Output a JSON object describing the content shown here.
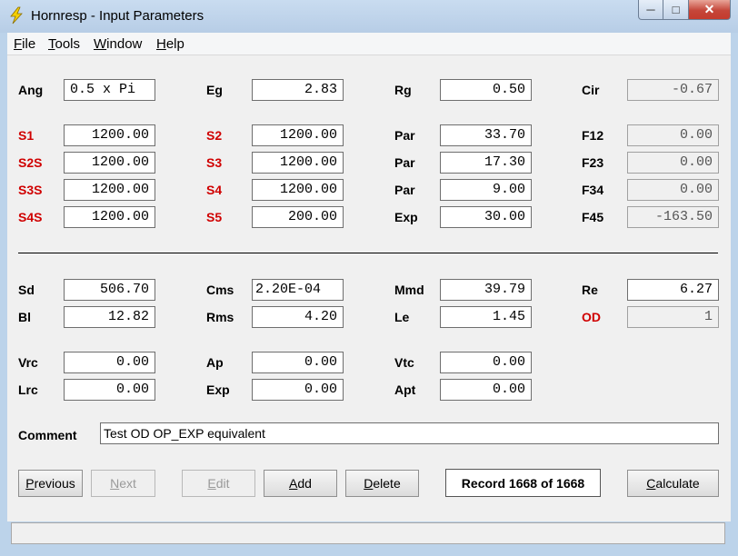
{
  "window": {
    "title": "Hornresp - Input Parameters",
    "icon": "lightning-icon"
  },
  "menu": [
    {
      "label_u": "F",
      "label_rest": "ile"
    },
    {
      "label_u": "T",
      "label_rest": "ools"
    },
    {
      "label_u": "W",
      "label_rest": "indow"
    },
    {
      "label_u": "H",
      "label_rest": "elp"
    }
  ],
  "params": {
    "ang": {
      "label": "Ang",
      "value": "0.5 x Pi"
    },
    "eg": {
      "label": "Eg",
      "value": "2.83"
    },
    "rg": {
      "label": "Rg",
      "value": "0.50"
    },
    "cir": {
      "label": "Cir",
      "value": "-0.67"
    },
    "s1": {
      "label": "S1",
      "value": "1200.00"
    },
    "s2": {
      "label": "S2",
      "value": "1200.00"
    },
    "par1": {
      "label": "Par",
      "value": "33.70"
    },
    "f12": {
      "label": "F12",
      "value": "0.00"
    },
    "s2s": {
      "label": "S2S",
      "value": "1200.00"
    },
    "s3": {
      "label": "S3",
      "value": "1200.00"
    },
    "par2": {
      "label": "Par",
      "value": "17.30"
    },
    "f23": {
      "label": "F23",
      "value": "0.00"
    },
    "s3s": {
      "label": "S3S",
      "value": "1200.00"
    },
    "s4": {
      "label": "S4",
      "value": "1200.00"
    },
    "par3": {
      "label": "Par",
      "value": "9.00"
    },
    "f34": {
      "label": "F34",
      "value": "0.00"
    },
    "s4s": {
      "label": "S4S",
      "value": "1200.00"
    },
    "s5": {
      "label": "S5",
      "value": "200.00"
    },
    "exp1": {
      "label": "Exp",
      "value": "30.00"
    },
    "f45": {
      "label": "F45",
      "value": "-163.50"
    },
    "sd": {
      "label": "Sd",
      "value": "506.70"
    },
    "cms": {
      "label": "Cms",
      "value": "2.20E-04"
    },
    "mmd": {
      "label": "Mmd",
      "value": "39.79"
    },
    "re": {
      "label": "Re",
      "value": "6.27"
    },
    "bl": {
      "label": "Bl",
      "value": "12.82"
    },
    "rms": {
      "label": "Rms",
      "value": "4.20"
    },
    "le": {
      "label": "Le",
      "value": "1.45"
    },
    "od": {
      "label": "OD",
      "value": "1"
    },
    "vrc": {
      "label": "Vrc",
      "value": "0.00"
    },
    "ap": {
      "label": "Ap",
      "value": "0.00"
    },
    "vtc": {
      "label": "Vtc",
      "value": "0.00"
    },
    "lrc": {
      "label": "Lrc",
      "value": "0.00"
    },
    "exp2": {
      "label": "Exp",
      "value": "0.00"
    },
    "apt": {
      "label": "Apt",
      "value": "0.00"
    }
  },
  "comment": {
    "label": "Comment",
    "value": "Test OD OP_EXP equivalent"
  },
  "buttons": {
    "previous": {
      "u": "P",
      "rest": "revious"
    },
    "next": {
      "u": "N",
      "rest": "ext"
    },
    "edit": {
      "u": "E",
      "rest": "dit"
    },
    "add": {
      "u": "A",
      "rest": "dd"
    },
    "delete": {
      "u": "D",
      "rest": "elete"
    },
    "calculate": {
      "u": "C",
      "rest": "alculate"
    }
  },
  "record": "Record 1668 of 1668",
  "colors": {
    "red_label": "#d00000",
    "titlebar": "#c9dcf0"
  }
}
